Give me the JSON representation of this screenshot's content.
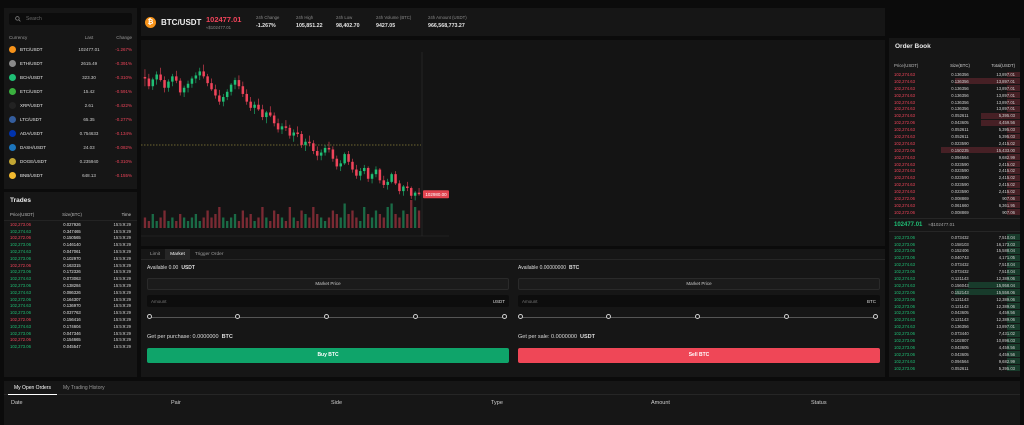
{
  "search": {
    "placeholder": "Search",
    "icon": "search-icon"
  },
  "markets": {
    "headers": {
      "currency": "Currency",
      "last": "Last",
      "change": "Change"
    },
    "rows": [
      {
        "symbol": "BTC/USDT",
        "last": "102477.01",
        "change": "-1.267%",
        "color": "#f7931a",
        "dir": "down"
      },
      {
        "symbol": "ETH/USDT",
        "last": "2615.49",
        "change": "-0.391%",
        "color": "#8a8a8a",
        "dir": "down"
      },
      {
        "symbol": "BCH/USDT",
        "last": "323.30",
        "change": "-0.310%",
        "color": "#1fbf75",
        "dir": "down"
      },
      {
        "symbol": "ETC/USDT",
        "last": "15.42",
        "change": "-0.591%",
        "color": "#3ab03e",
        "dir": "down"
      },
      {
        "symbol": "XRP/USDT",
        "last": "2.61",
        "change": "-0.422%",
        "color": "#222222",
        "dir": "down"
      },
      {
        "symbol": "LTC/USDT",
        "last": "65.35",
        "change": "-0.277%",
        "color": "#345d9d",
        "dir": "down"
      },
      {
        "symbol": "ADA/USDT",
        "last": "0.754633",
        "change": "-0.134%",
        "color": "#0033ad",
        "dir": "down"
      },
      {
        "symbol": "DASH/USDT",
        "last": "24.03",
        "change": "-0.082%",
        "color": "#1c75bc",
        "dir": "down"
      },
      {
        "symbol": "DOGE/USDT",
        "last": "0.235940",
        "change": "-0.310%",
        "color": "#c2a633",
        "dir": "down"
      },
      {
        "symbol": "BNB/USDT",
        "last": "648.13",
        "change": "-0.155%",
        "color": "#f3ba2f",
        "dir": "down"
      }
    ]
  },
  "trades": {
    "title": "Trades",
    "headers": {
      "price": "Price(USDT)",
      "size": "Size(BTC)",
      "time": "Time"
    },
    "rows": [
      {
        "price": "102,273.06",
        "size": "0.027926",
        "time": "15:5:9:29",
        "dir": "down"
      },
      {
        "price": "102,274.63",
        "size": "0.347465",
        "time": "15:5:9:29",
        "dir": "up"
      },
      {
        "price": "102,272.06",
        "size": "0.150565",
        "time": "15:5:9:29",
        "dir": "down"
      },
      {
        "price": "102,273.06",
        "size": "0.146140",
        "time": "15:5:9:29",
        "dir": "up"
      },
      {
        "price": "102,274.63",
        "size": "0.047061",
        "time": "15:5:9:29",
        "dir": "up"
      },
      {
        "price": "102,273.06",
        "size": "0.102970",
        "time": "15:5:9:29",
        "dir": "up"
      },
      {
        "price": "102,272.06",
        "size": "0.163315",
        "time": "15:5:9:29",
        "dir": "down"
      },
      {
        "price": "102,273.06",
        "size": "0.172326",
        "time": "15:5:9:29",
        "dir": "up"
      },
      {
        "price": "102,274.63",
        "size": "0.073063",
        "time": "15:5:9:29",
        "dir": "up"
      },
      {
        "price": "102,273.06",
        "size": "0.138284",
        "time": "15:5:9:29",
        "dir": "up"
      },
      {
        "price": "102,274.63",
        "size": "0.086326",
        "time": "15:5:9:29",
        "dir": "up"
      },
      {
        "price": "102,272.06",
        "size": "0.164307",
        "time": "15:5:9:29",
        "dir": "up"
      },
      {
        "price": "102,274.63",
        "size": "0.136970",
        "time": "15:5:9:29",
        "dir": "up"
      },
      {
        "price": "102,273.06",
        "size": "0.037763",
        "time": "15:5:9:29",
        "dir": "up"
      },
      {
        "price": "102,272.06",
        "size": "0.156416",
        "time": "15:5:9:29",
        "dir": "down"
      },
      {
        "price": "102,274.63",
        "size": "0.174604",
        "time": "15:5:9:29",
        "dir": "up"
      },
      {
        "price": "102,273.06",
        "size": "0.047346",
        "time": "15:5:9:29",
        "dir": "up"
      },
      {
        "price": "102,272.06",
        "size": "0.154665",
        "time": "15:5:9:29",
        "dir": "down"
      },
      {
        "price": "102,273.06",
        "size": "0.045547",
        "time": "15:5:9:29",
        "dir": "up"
      }
    ]
  },
  "header": {
    "pair": "BTC/USDT",
    "price": "102477.01",
    "price_sub": "≈$102477.01",
    "stats": [
      {
        "label": "24h Change",
        "value": "-1.267%",
        "dir": "down"
      },
      {
        "label": "24h High",
        "value": "105,851.22",
        "dir": "none"
      },
      {
        "label": "24h Low",
        "value": "98,402.70",
        "dir": "none"
      },
      {
        "label": "24h Volume (BTC)",
        "value": "9427.05",
        "dir": "none"
      },
      {
        "label": "24h Amount (USDT)",
        "value": "966,568,773.27",
        "dir": "none"
      }
    ]
  },
  "chart_data": {
    "type": "candlestick",
    "last_price_label": "102980.00",
    "ohlc": [
      [
        104800,
        105050,
        104500,
        104750
      ],
      [
        104750,
        104900,
        104400,
        104500
      ],
      [
        104500,
        104780,
        104380,
        104720
      ],
      [
        104720,
        104980,
        104550,
        104880
      ],
      [
        104880,
        105100,
        104650,
        104700
      ],
      [
        104700,
        104820,
        104300,
        104450
      ],
      [
        104450,
        104720,
        104320,
        104650
      ],
      [
        104650,
        104900,
        104500,
        104820
      ],
      [
        104820,
        105000,
        104600,
        104680
      ],
      [
        104680,
        104760,
        104200,
        104300
      ],
      [
        104300,
        104520,
        104150,
        104450
      ],
      [
        104450,
        104680,
        104300,
        104580
      ],
      [
        104580,
        104820,
        104450,
        104750
      ],
      [
        104750,
        104950,
        104600,
        104850
      ],
      [
        104850,
        105100,
        104700,
        104980
      ],
      [
        104980,
        105200,
        104750,
        104820
      ],
      [
        104820,
        104900,
        104500,
        104600
      ],
      [
        104600,
        104750,
        104350,
        104400
      ],
      [
        104400,
        104550,
        104100,
        104200
      ],
      [
        104200,
        104380,
        103900,
        104000
      ],
      [
        104000,
        104250,
        103850,
        104150
      ],
      [
        104150,
        104400,
        104050,
        104320
      ],
      [
        104320,
        104600,
        104200,
        104550
      ],
      [
        104550,
        104780,
        104400,
        104700
      ],
      [
        104700,
        104850,
        104400,
        104500
      ],
      [
        104500,
        104650,
        104150,
        104250
      ],
      [
        104250,
        104400,
        103900,
        104000
      ],
      [
        104000,
        104150,
        103700,
        103800
      ],
      [
        103800,
        104000,
        103600,
        103900
      ],
      [
        103900,
        104100,
        103700,
        103750
      ],
      [
        103750,
        103900,
        103400,
        103500
      ],
      [
        103500,
        103700,
        103300,
        103650
      ],
      [
        103650,
        103850,
        103500,
        103550
      ],
      [
        103550,
        103650,
        103200,
        103300
      ],
      [
        103300,
        103450,
        103000,
        103100
      ],
      [
        103100,
        103300,
        102950,
        103200
      ],
      [
        103200,
        103400,
        103050,
        103150
      ],
      [
        103150,
        103250,
        102800,
        102900
      ],
      [
        102900,
        103100,
        102700,
        103000
      ],
      [
        103000,
        103200,
        102850,
        102950
      ],
      [
        102950,
        103050,
        102500,
        102600
      ],
      [
        102600,
        102800,
        102400,
        102700
      ],
      [
        102700,
        102900,
        102550,
        102650
      ],
      [
        102650,
        102750,
        102300,
        102400
      ],
      [
        102400,
        102550,
        102100,
        102250
      ],
      [
        102250,
        102450,
        102100,
        102350
      ],
      [
        102350,
        102600,
        102250,
        102500
      ],
      [
        102500,
        102700,
        102350,
        102450
      ],
      [
        102450,
        102550,
        102050,
        102150
      ],
      [
        102150,
        102250,
        101800,
        101900
      ],
      [
        101900,
        102100,
        101750,
        102000
      ],
      [
        102000,
        102350,
        101950,
        102300
      ],
      [
        102300,
        102400,
        101950,
        102050
      ],
      [
        102050,
        102150,
        101700,
        101800
      ],
      [
        101800,
        101950,
        101500,
        101600
      ],
      [
        101600,
        101850,
        101450,
        101750
      ],
      [
        101750,
        101950,
        101650,
        101850
      ],
      [
        101850,
        101900,
        101400,
        101500
      ],
      [
        101500,
        101700,
        101350,
        101650
      ],
      [
        101650,
        101900,
        101550,
        101800
      ],
      [
        101800,
        101850,
        101350,
        101450
      ],
      [
        101450,
        101600,
        101200,
        101300
      ],
      [
        101300,
        101500,
        101150,
        101400
      ],
      [
        101400,
        101700,
        101350,
        101650
      ],
      [
        101650,
        101750,
        101300,
        101350
      ],
      [
        101350,
        101450,
        101000,
        101100
      ],
      [
        101100,
        101300,
        100950,
        101250
      ],
      [
        101250,
        101400,
        101100,
        101200
      ],
      [
        101200,
        101250,
        100850,
        100950
      ],
      [
        100950,
        101100,
        100800,
        101050
      ],
      [
        101050,
        101200,
        100950,
        101000
      ]
    ],
    "volumes": [
      3,
      2,
      4,
      2,
      3,
      5,
      2,
      3,
      2,
      4,
      3,
      2,
      3,
      4,
      2,
      3,
      5,
      3,
      4,
      6,
      3,
      2,
      3,
      4,
      2,
      5,
      3,
      4,
      2,
      3,
      6,
      3,
      2,
      5,
      4,
      3,
      2,
      6,
      3,
      2,
      5,
      4,
      3,
      6,
      4,
      3,
      2,
      3,
      5,
      4,
      3,
      7,
      4,
      5,
      3,
      2,
      6,
      4,
      3,
      5,
      4,
      3,
      6,
      7,
      4,
      3,
      5,
      4,
      8,
      6,
      5
    ]
  },
  "order_form": {
    "tabs": [
      "Limit",
      "Market",
      "Trigger Order"
    ],
    "buy": {
      "available_label": "Available 0.00",
      "available_unit": "USDT",
      "market_price": "Market Price",
      "amount_placeholder": "Amount",
      "amount_unit": "USDT",
      "get_label": "Get per purchase: 0.0000000",
      "get_unit": "BTC",
      "button": "Buy BTC"
    },
    "sell": {
      "available_label": "Available 0.00000000",
      "available_unit": "BTC",
      "market_price": "Market Price",
      "amount_placeholder": "Amount",
      "amount_unit": "BTC",
      "get_label": "Get per sale: 0.0000000",
      "get_unit": "USDT",
      "button": "Sell BTC"
    }
  },
  "order_book": {
    "title": "Order Book",
    "headers": {
      "price": "Price(USDT)",
      "size": "Size(BTC)",
      "total": "Total(USDT)"
    },
    "asks": [
      {
        "price": "102,274.63",
        "size": "0.136356",
        "total": "13,897.01",
        "depth": 0.1
      },
      {
        "price": "102,274.63",
        "size": "0.136356",
        "total": "13,897.01",
        "depth": 0.5
      },
      {
        "price": "102,274.63",
        "size": "0.136356",
        "total": "13,897.01",
        "depth": 0.1
      },
      {
        "price": "102,274.63",
        "size": "0.136356",
        "total": "13,897.01",
        "depth": 0.1
      },
      {
        "price": "102,274.63",
        "size": "0.136356",
        "total": "13,897.01",
        "depth": 0.1
      },
      {
        "price": "102,274.63",
        "size": "0.136356",
        "total": "13,897.01",
        "depth": 0.1
      },
      {
        "price": "102,274.63",
        "size": "0.052611",
        "total": "5,395.03",
        "depth": 0.3
      },
      {
        "price": "102,272.06",
        "size": "0.043605",
        "total": "4,459.56",
        "depth": 0.3
      },
      {
        "price": "102,274.63",
        "size": "0.052611",
        "total": "5,395.03",
        "depth": 0.1
      },
      {
        "price": "102,274.63",
        "size": "0.052611",
        "total": "5,395.03",
        "depth": 0.1
      },
      {
        "price": "102,274.63",
        "size": "0.023590",
        "total": "2,415.02",
        "depth": 0.1
      },
      {
        "price": "102,272.06",
        "size": "0.150235",
        "total": "15,433.00",
        "depth": 0.6
      },
      {
        "price": "102,274.63",
        "size": "0.094564",
        "total": "9,682.99",
        "depth": 0.1
      },
      {
        "price": "102,274.63",
        "size": "0.023590",
        "total": "2,415.02",
        "depth": 0.1
      },
      {
        "price": "102,274.63",
        "size": "0.023590",
        "total": "2,415.02",
        "depth": 0.1
      },
      {
        "price": "102,274.63",
        "size": "0.023590",
        "total": "2,415.02",
        "depth": 0.1
      },
      {
        "price": "102,274.63",
        "size": "0.023590",
        "total": "2,415.02",
        "depth": 0.1
      },
      {
        "price": "102,274.63",
        "size": "0.023590",
        "total": "2,415.02",
        "depth": 0.1
      },
      {
        "price": "102,272.06",
        "size": "0.008869",
        "total": "907.06",
        "depth": 0.1
      },
      {
        "price": "102,274.63",
        "size": "0.061660",
        "total": "6,361.95",
        "depth": 0.1
      },
      {
        "price": "102,272.06",
        "size": "0.008869",
        "total": "907.06",
        "depth": 0.1
      }
    ],
    "mid_price": "102477.01",
    "mid_sub": "≈$102477.01",
    "bids": [
      {
        "price": "102,273.06",
        "size": "0.073432",
        "total": "7,510.04",
        "depth": 0.1
      },
      {
        "price": "102,273.06",
        "size": "0.158103",
        "total": "16,173.03",
        "depth": 0.1
      },
      {
        "price": "102,273.06",
        "size": "0.152406",
        "total": "15,588.04",
        "depth": 0.1
      },
      {
        "price": "102,273.06",
        "size": "0.040743",
        "total": "4,171.05",
        "depth": 0.1
      },
      {
        "price": "102,274.63",
        "size": "0.073432",
        "total": "7,510.04",
        "depth": 0.1
      },
      {
        "price": "102,273.06",
        "size": "0.073432",
        "total": "7,510.04",
        "depth": 0.1
      },
      {
        "price": "102,274.63",
        "size": "0.121143",
        "total": "12,389.06",
        "depth": 0.1
      },
      {
        "price": "102,274.63",
        "size": "0.156043",
        "total": "15,958.04",
        "depth": 0.4
      },
      {
        "price": "102,272.06",
        "size": "0.152143",
        "total": "15,558.06",
        "depth": 0.5
      },
      {
        "price": "102,273.06",
        "size": "0.121143",
        "total": "12,389.06",
        "depth": 0.1
      },
      {
        "price": "102,273.06",
        "size": "0.121143",
        "total": "12,389.06",
        "depth": 0.1
      },
      {
        "price": "102,273.06",
        "size": "0.043605",
        "total": "4,459.56",
        "depth": 0.1
      },
      {
        "price": "102,274.63",
        "size": "0.121143",
        "total": "12,389.06",
        "depth": 0.1
      },
      {
        "price": "102,274.63",
        "size": "0.136356",
        "total": "13,897.01",
        "depth": 0.1
      },
      {
        "price": "102,273.06",
        "size": "0.073440",
        "total": "7,431.02",
        "depth": 0.1
      },
      {
        "price": "102,273.06",
        "size": "0.102807",
        "total": "10,896.03",
        "depth": 0.1
      },
      {
        "price": "102,273.06",
        "size": "0.043605",
        "total": "4,459.56",
        "depth": 0.1
      },
      {
        "price": "102,273.06",
        "size": "0.043605",
        "total": "4,459.56",
        "depth": 0.1
      },
      {
        "price": "102,274.63",
        "size": "0.094564",
        "total": "9,682.99",
        "depth": 0.1
      },
      {
        "price": "102,273.06",
        "size": "0.052611",
        "total": "5,395.03",
        "depth": 0.1
      }
    ]
  },
  "open_orders": {
    "tabs": [
      "My Open Orders",
      "My Trading History"
    ],
    "columns": [
      "Date",
      "Pair",
      "Side",
      "Type",
      "Amount",
      "Status"
    ]
  }
}
